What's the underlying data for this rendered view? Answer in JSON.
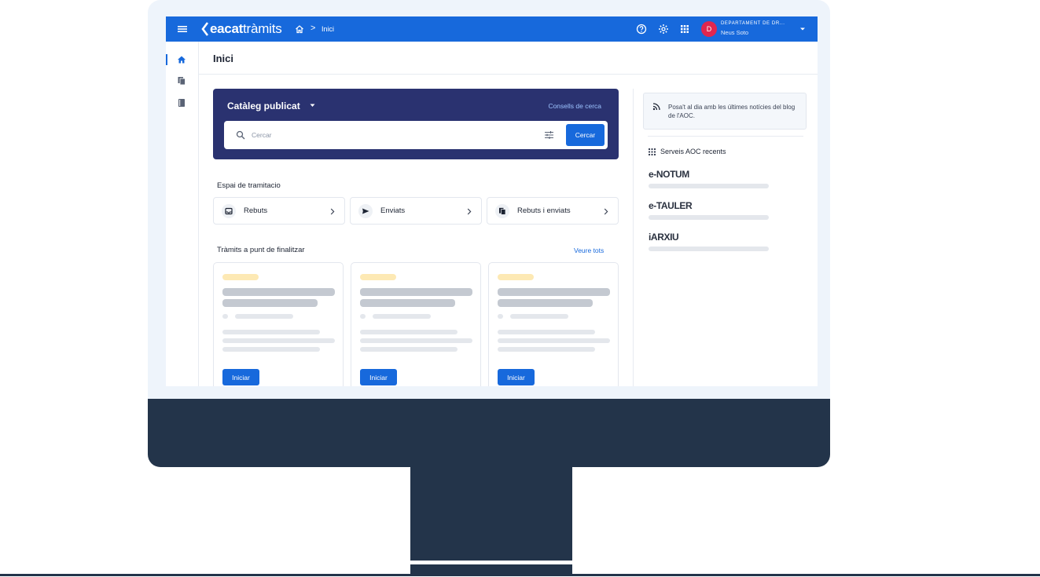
{
  "topbar": {
    "brand_bold": "eacat",
    "brand_light": "tràmits",
    "breadcrumb_current": "Inici",
    "breadcrumb_separator": ">",
    "avatar_initial": "D",
    "department": "DEPARTAMENT DE DR...",
    "user_name": "Neus Soto",
    "icons": [
      "menu-icon",
      "home-icon",
      "help-icon",
      "settings-icon",
      "apps-grid-icon",
      "chevron-down-icon"
    ]
  },
  "sidebar": {
    "items": [
      {
        "icon": "home-icon",
        "active": true
      },
      {
        "icon": "documents-icon",
        "active": false
      },
      {
        "icon": "book-icon",
        "active": false
      }
    ]
  },
  "page": {
    "title": "Inici"
  },
  "catalog": {
    "title": "Catàleg publicat",
    "tips_link": "Consells de cerca",
    "search_placeholder": "Cercar",
    "search_button": "Cercar"
  },
  "workspace": {
    "title": "Espai de tramitacio",
    "tiles": [
      {
        "label": "Rebuts",
        "icon": "inbox-icon"
      },
      {
        "label": "Enviats",
        "icon": "send-icon"
      },
      {
        "label": "Rebuts i enviats",
        "icon": "copy-icon"
      }
    ]
  },
  "pending": {
    "title": "Tràmits a punt de finalitzar",
    "see_all": "Veure tots",
    "cards": [
      {
        "button": "Iniciar"
      },
      {
        "button": "Iniciar"
      },
      {
        "button": "Iniciar"
      }
    ]
  },
  "aside": {
    "blog_text": "Posa't al dia amb les últimes notícies del blog de l'AOC.",
    "recent_title": "Serveis AOC recents",
    "services": [
      "e-NOTUM",
      "e-TAULER",
      "iARXIU"
    ]
  },
  "colors": {
    "primary": "#1769dc",
    "catalog_bg": "#2a3270",
    "monitor": "#23344a",
    "avatar": "#e0264f",
    "skeleton_accent": "#fde9b4"
  }
}
